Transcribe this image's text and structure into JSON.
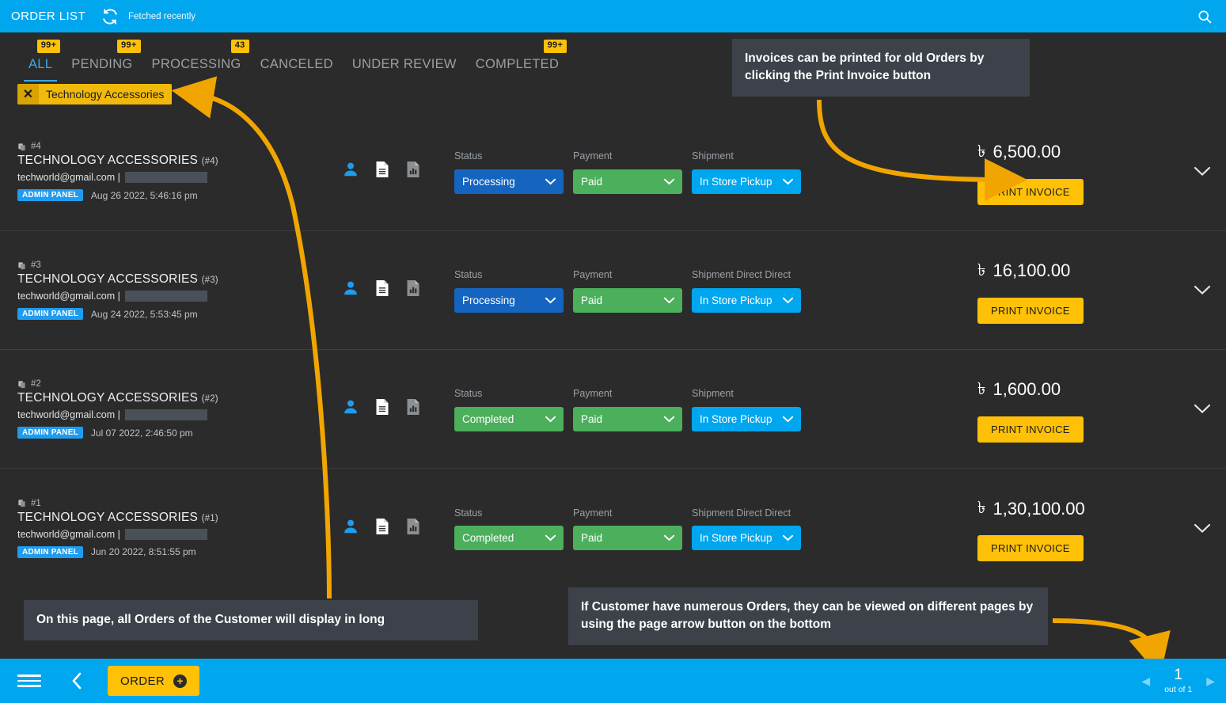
{
  "header": {
    "title": "ORDER LIST",
    "refresh_icon": "refresh-icon",
    "fetched_status": "Fetched recently",
    "search_icon": "search-icon"
  },
  "tabs": [
    {
      "label": "ALL",
      "badge": "99+",
      "active": true
    },
    {
      "label": "PENDING",
      "badge": "99+",
      "active": false
    },
    {
      "label": "PROCESSING",
      "badge": "43",
      "active": false
    },
    {
      "label": "CANCELED",
      "badge": "",
      "active": false
    },
    {
      "label": "UNDER REVIEW",
      "badge": "",
      "active": false
    },
    {
      "label": "COMPLETED",
      "badge": "99+",
      "active": false
    }
  ],
  "filter_chip": {
    "close_icon": "close-icon",
    "label": "Technology Accessories"
  },
  "field_labels": {
    "status": "Status",
    "payment": "Payment",
    "shipment": "Shipment",
    "shipment_direct": "Shipment Direct Direct"
  },
  "orders": [
    {
      "hash": "#4",
      "title": "TECHNOLOGY ACCESSORIES",
      "number": "(#4)",
      "email": "techworld@gmail.com |",
      "source_pill": "ADMIN PANEL",
      "date": "Aug 26 2022, 5:46:16 pm",
      "status": "Processing",
      "status_color": "#1565c0",
      "payment": "Paid",
      "payment_color": "#4caf5c",
      "shipment_label": "Shipment",
      "shipment": "In Store Pickup",
      "shipment_color": "#00a6ee",
      "currency": "৳",
      "amount": "6,500.00",
      "print_label": "PRINT INVOICE"
    },
    {
      "hash": "#3",
      "title": "TECHNOLOGY ACCESSORIES",
      "number": "(#3)",
      "email": "techworld@gmail.com |",
      "source_pill": "ADMIN PANEL",
      "date": "Aug 24 2022, 5:53:45 pm",
      "status": "Processing",
      "status_color": "#1565c0",
      "payment": "Paid",
      "payment_color": "#4caf5c",
      "shipment_label": "Shipment Direct Direct",
      "shipment": "In Store Pickup",
      "shipment_color": "#00a6ee",
      "currency": "৳",
      "amount": "16,100.00",
      "print_label": "PRINT INVOICE"
    },
    {
      "hash": "#2",
      "title": "TECHNOLOGY ACCESSORIES",
      "number": "(#2)",
      "email": "techworld@gmail.com |",
      "source_pill": "ADMIN PANEL",
      "date": "Jul 07 2022, 2:46:50 pm",
      "status": "Completed",
      "status_color": "#4caf5c",
      "payment": "Paid",
      "payment_color": "#4caf5c",
      "shipment_label": "Shipment",
      "shipment": "In Store Pickup",
      "shipment_color": "#00a6ee",
      "currency": "৳",
      "amount": "1,600.00",
      "print_label": "PRINT INVOICE"
    },
    {
      "hash": "#1",
      "title": "TECHNOLOGY ACCESSORIES",
      "number": "(#1)",
      "email": "techworld@gmail.com |",
      "source_pill": "ADMIN PANEL",
      "date": "Jun 20 2022, 8:51:55 pm",
      "status": "Completed",
      "status_color": "#4caf5c",
      "payment": "Paid",
      "payment_color": "#4caf5c",
      "shipment_label": "Shipment Direct Direct",
      "shipment": "In Store Pickup",
      "shipment_color": "#00a6ee",
      "currency": "৳",
      "amount": "1,30,100.00",
      "print_label": "PRINT INVOICE"
    }
  ],
  "annotations": {
    "print_invoice_note": "Invoices can be printed for old Orders by clicking the Print Invoice button",
    "orders_list_note": "On this page, all Orders of the Customer will display in long",
    "pagination_note": "If Customer have numerous Orders, they can be viewed on different pages by using the page arrow button on the bottom"
  },
  "footer": {
    "menu_icon": "hamburger-menu-icon",
    "back_icon": "chevron-left-icon",
    "order_button": "ORDER",
    "order_plus_icon": "plus-circle-icon",
    "prev_icon": "triangle-left-icon",
    "next_icon": "triangle-right-icon",
    "page_number": "1",
    "page_total": "out of 1"
  },
  "colors": {
    "brand_blue": "#00a6ee",
    "accent_yellow": "#ffc107",
    "filter_yellow": "#f0b90b",
    "green": "#4caf5c",
    "dark_blue": "#1565c0",
    "bg": "#2b2b2b",
    "callout_bg": "#3c414a",
    "arrow_orange": "#f0a500"
  }
}
